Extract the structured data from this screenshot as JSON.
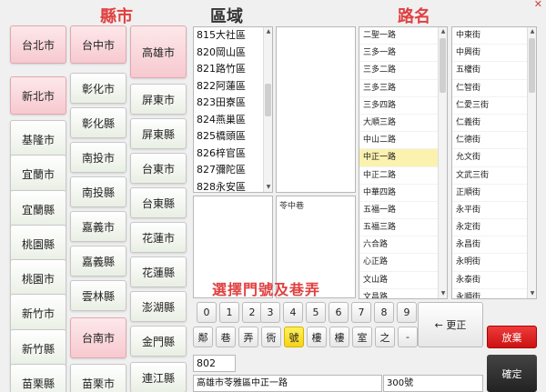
{
  "headers": {
    "county": "縣市",
    "area": "區域",
    "road": "路名"
  },
  "counties_col1": [
    "台北市",
    "新北市",
    "基隆市",
    "宜蘭市",
    "宜蘭縣",
    "桃園縣",
    "桃園市",
    "新竹市",
    "新竹縣",
    "苗栗縣"
  ],
  "counties_col2": [
    "台中市",
    "彰化市",
    "彰化縣",
    "南投市",
    "南投縣",
    "嘉義市",
    "嘉義縣",
    "雲林縣",
    "台南市",
    "苗栗市"
  ],
  "counties_col3": [
    "高雄市",
    "屏東市",
    "屏東縣",
    "台東市",
    "台東縣",
    "花蓮市",
    "花蓮縣",
    "澎湖縣",
    "金門縣",
    "連江縣"
  ],
  "areas": [
    "815大社區",
    "820岡山區",
    "821路竹區",
    "822阿蓮區",
    "823田寮區",
    "824燕巢區",
    "825橋頭區",
    "826梓官區",
    "827彌陀區",
    "828永安區"
  ],
  "lane_preview": "苓中巷",
  "roads": [
    "二聖一路",
    "三多一路",
    "三多二路",
    "三多三路",
    "三多四路",
    "大順三路",
    "中山二路",
    "中正一路",
    "中正二路",
    "中華四路",
    "五福一路",
    "五福三路",
    "六合路",
    "心正路",
    "文山路",
    "文昌路"
  ],
  "streets": [
    "中東街",
    "中興街",
    "五權街",
    "仁智街",
    "仁愛三街",
    "仁義街",
    "仁德街",
    "允文街",
    "文武三街",
    "正順街",
    "永平街",
    "永定街",
    "永昌街",
    "永明街",
    "永泰街",
    "永順街"
  ],
  "select_title": "選擇門號及巷弄",
  "digits": [
    "0",
    "1",
    "2",
    "3",
    "4",
    "5",
    "6",
    "7",
    "8",
    "9"
  ],
  "units": [
    "鄰",
    "巷",
    "弄",
    "衖",
    "號",
    "樓",
    "樓",
    "室",
    "之",
    "-"
  ],
  "back_label": "← 更正",
  "giveup_label": "放棄",
  "confirm_label": "確定",
  "number_value": "802",
  "address_value": "高雄市苓雅區中正一路",
  "house_value": "300號",
  "colors": {
    "accent_red": "#e04040",
    "highlight_yellow": "#f5d21c",
    "selected_row": "#fbf2b0"
  }
}
